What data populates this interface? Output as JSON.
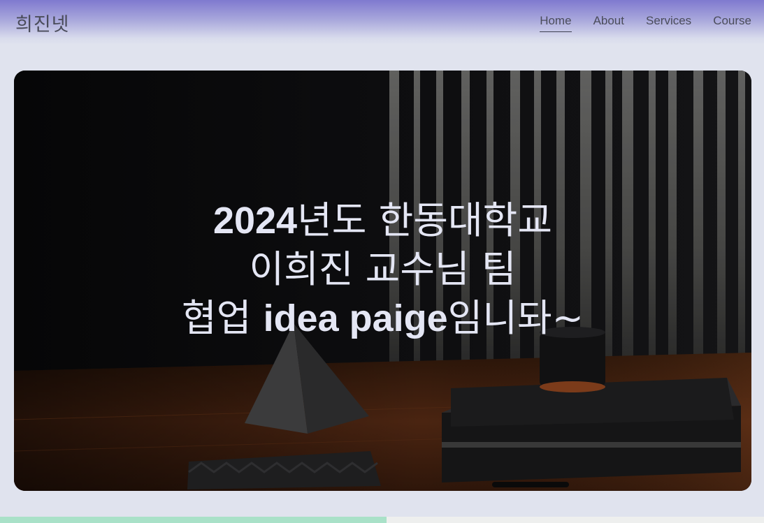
{
  "brand": {
    "name": "희진넷"
  },
  "nav": {
    "items": [
      {
        "label": "Home",
        "active": true
      },
      {
        "label": "About"
      },
      {
        "label": "Services"
      },
      {
        "label": "Course"
      }
    ]
  },
  "hero": {
    "line1_bold": "2024",
    "line1_rest": "년도 한동대학교",
    "line2": "이희진 교수님 팀",
    "line3_start": "협업 ",
    "line3_bold": "idea paige",
    "line3_end": "임니돠~"
  },
  "colors": {
    "nav_gradient_top": "#7f79cf",
    "page_background": "#e0e3ee",
    "hero_text": "#e4e6f4",
    "accent_strip": "#a9e1c8"
  }
}
